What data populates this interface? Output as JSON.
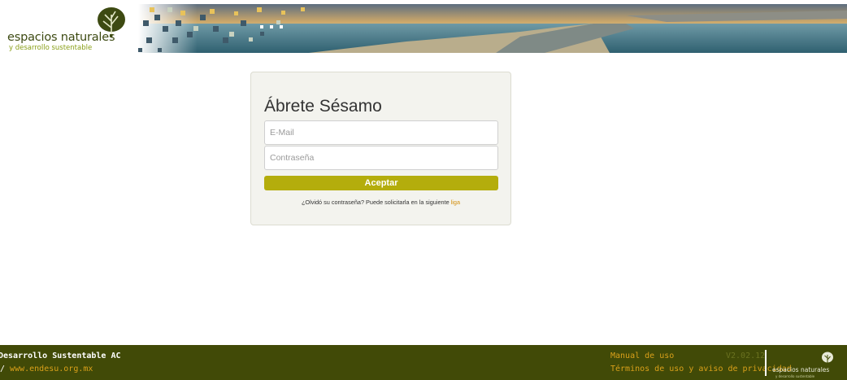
{
  "header": {
    "logo_name": "espacios naturales",
    "logo_tagline": "y desarrollo sustentable"
  },
  "login": {
    "title": "Ábrete Sésamo",
    "email_placeholder": "E-Mail",
    "password_placeholder": "Contraseña",
    "submit_label": "Aceptar",
    "forgot_text": "¿Olvidó su contraseña? Puede solicitarla en la siguiente ",
    "forgot_link": "liga"
  },
  "footer": {
    "org": "Desarrollo Sustentable AC",
    "site_separator": "/ ",
    "site_url": "www.endesu.org.mx",
    "manual_link": "Manual de uso",
    "version": "V2.02.12",
    "terms_link": "Términos de uso y aviso de privacidad",
    "logo_name": "espacios naturales",
    "logo_tagline": "y desarrollo sustentable"
  },
  "colors": {
    "accent": "#b4ad0c",
    "footer_bg": "#414a07",
    "link": "#d28f0e",
    "card_bg": "#f3f3ee"
  },
  "icons": {
    "logo_icon": "leaf-tree-icon"
  }
}
